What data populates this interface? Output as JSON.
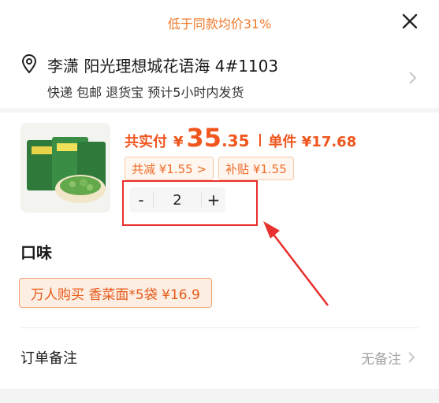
{
  "banner": {
    "text": "低于同款均价31%"
  },
  "address": {
    "line": "李潇 阳光理想城花语海 4#1103",
    "shipping": "快递 包邮 退货宝 预计5小时内发货"
  },
  "product": {
    "total_label": "共实付",
    "currency": "¥",
    "price_int": "35",
    "price_dec": ".35",
    "unit_label": "单件 ¥17.68",
    "discount_badge": "共减 ¥1.55 >",
    "subsidy_badge": "补贴 ¥1.55"
  },
  "quantity": {
    "minus": "-",
    "value": "2",
    "plus": "+"
  },
  "flavor": {
    "title": "口味",
    "selected_option": "万人购买  香菜面*5袋 ¥16.9"
  },
  "remark": {
    "label": "订单备注",
    "value": "无备注"
  },
  "colors": {
    "accent": "#f0561e",
    "highlight": "#e8302e",
    "banner": "#f07828"
  },
  "icons": [
    "close-icon",
    "location-pin-icon",
    "chevron-right-icon"
  ]
}
